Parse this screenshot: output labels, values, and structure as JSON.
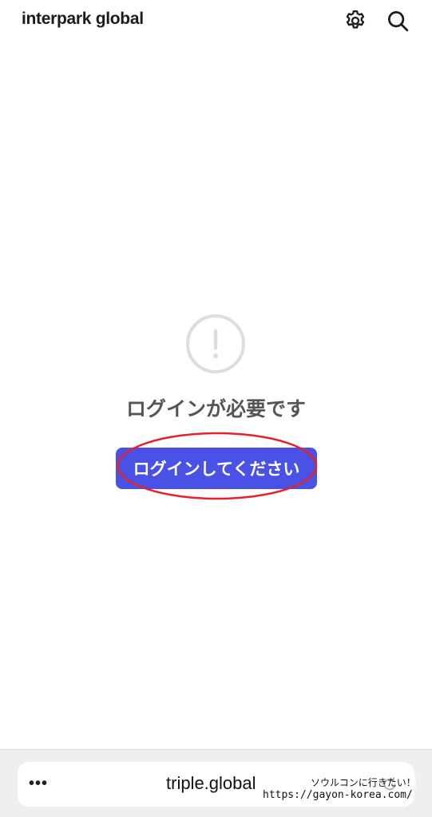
{
  "header": {
    "brand": "interpark global",
    "gear_icon": "gear-icon",
    "search_icon": "search-icon"
  },
  "main": {
    "alert_icon": "exclamation-circle-icon",
    "message": "ログインが必要です",
    "login_button_label": "ログインしてください"
  },
  "browser_bar": {
    "menu_label": "•••",
    "url": "triple.global",
    "reload_icon": "reload-icon"
  },
  "watermark": {
    "line1": "ソウルコンに行きたい！",
    "line2": "https://gayon-korea.com/"
  },
  "colors": {
    "primary_button": "#4a52e6",
    "annotation": "#e2232a",
    "message_text": "#555555"
  }
}
